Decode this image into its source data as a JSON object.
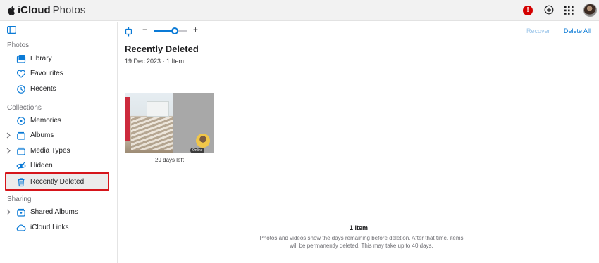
{
  "app": {
    "brand_name": "iCloud",
    "product_name": "Photos"
  },
  "header": {
    "alert_badge": "!"
  },
  "sidebar": {
    "sections": {
      "photos": "Photos",
      "collections": "Collections",
      "sharing": "Sharing"
    },
    "items": [
      {
        "label": "Library",
        "icon": "library-icon"
      },
      {
        "label": "Favourites",
        "icon": "heart-icon"
      },
      {
        "label": "Recents",
        "icon": "clock-icon"
      },
      {
        "label": "Memories",
        "icon": "memories-icon"
      },
      {
        "label": "Albums",
        "icon": "album-icon"
      },
      {
        "label": "Media Types",
        "icon": "media-types-icon"
      },
      {
        "label": "Hidden",
        "icon": "eye-icon"
      },
      {
        "label": "Recently Deleted",
        "icon": "trash-icon"
      },
      {
        "label": "Shared Albums",
        "icon": "shared-album-icon"
      },
      {
        "label": "iCloud Links",
        "icon": "cloud-link-icon"
      }
    ]
  },
  "toolbar": {
    "zoom_minus": "−",
    "zoom_plus": "+",
    "zoom_level": 0.62,
    "recover_label": "Recover",
    "delete_all_label": "Delete All"
  },
  "main": {
    "title": "Recently Deleted",
    "subtitle": "19 Dec 2023 · 1 Item",
    "photo": {
      "caption": "29 days left",
      "badge": "Online"
    },
    "footer": {
      "count": "1 Item",
      "note": "Photos and videos show the days remaining before deletion. After that time, items will be permanently deleted. This may take up to 40 days."
    }
  },
  "colors": {
    "accent": "#0a7ad6",
    "highlight_border": "#d6151b",
    "alert": "#d40000"
  }
}
